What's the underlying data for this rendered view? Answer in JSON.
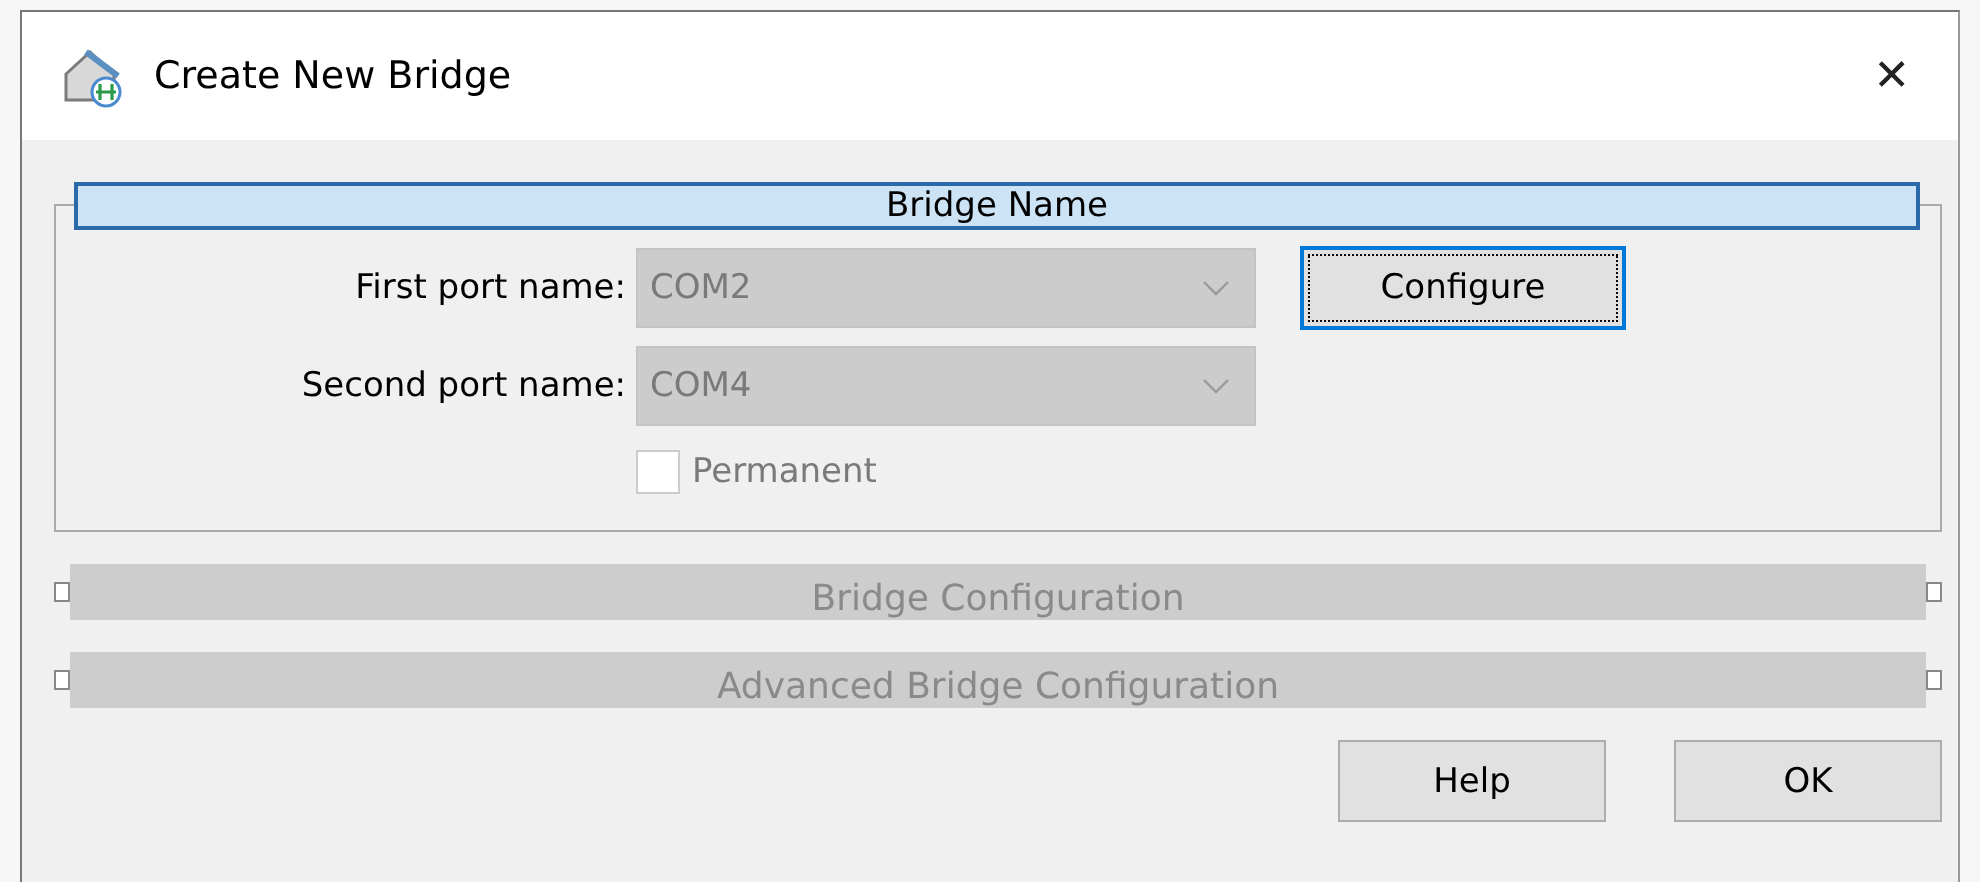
{
  "window": {
    "title": "Create New Bridge",
    "close": "✕"
  },
  "sections": [
    {
      "title": "Bridge Name",
      "expanded": true,
      "fields": [
        {
          "kind": "dropdown",
          "label": "First port name:",
          "value": "COM2",
          "disabled": true,
          "button": {
            "label": "Configure",
            "focused": true
          }
        },
        {
          "kind": "dropdown",
          "label": "Second port name:",
          "value": "COM4",
          "disabled": true
        },
        {
          "kind": "checkbox",
          "label": "Permanent",
          "checked": false,
          "disabled": true
        }
      ]
    },
    {
      "title": "Bridge Configuration",
      "expanded": false
    },
    {
      "title": "Advanced Bridge Configuration",
      "expanded": false
    }
  ],
  "buttons": [
    "Help",
    "OK"
  ]
}
